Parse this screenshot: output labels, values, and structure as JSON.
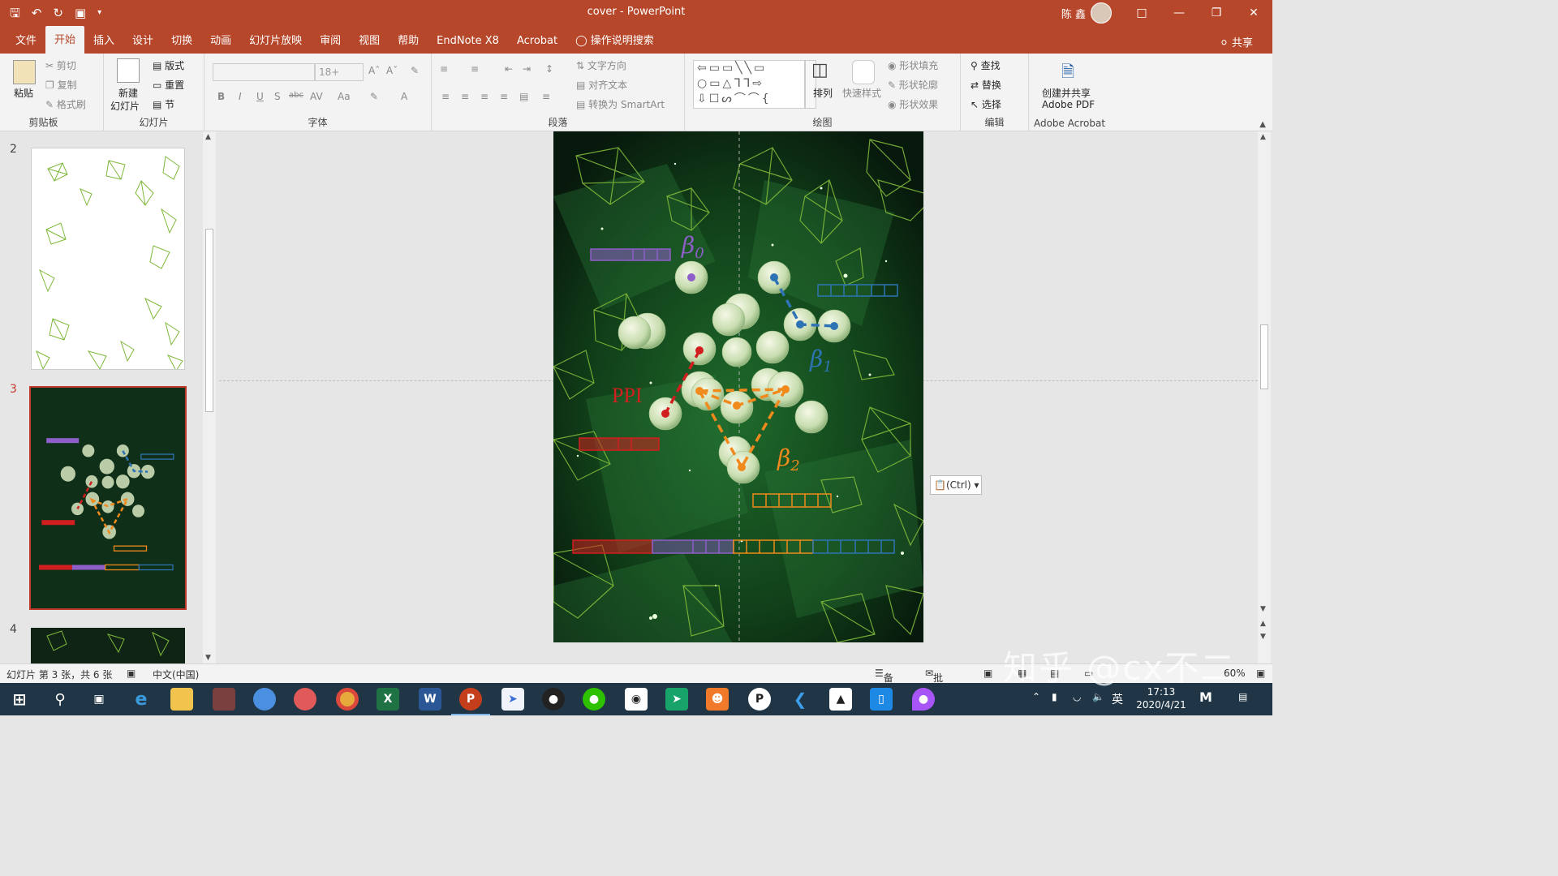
{
  "window": {
    "doc_name": "cover",
    "separator": "-",
    "app_name": "PowerPoint",
    "user_name": "陈 鑫"
  },
  "menu": {
    "tabs": [
      "文件",
      "开始",
      "插入",
      "设计",
      "切换",
      "动画",
      "幻灯片放映",
      "审阅",
      "视图",
      "帮助",
      "EndNote X8",
      "Acrobat"
    ],
    "active_tab": "开始",
    "tell_me": "操作说明搜索",
    "share": "共享"
  },
  "ribbon": {
    "clipboard": {
      "paste": "粘贴",
      "cut": "剪切",
      "copy": "复制",
      "format_painter": "格式刷",
      "label": "剪贴板"
    },
    "slides": {
      "new_slide": "新建",
      "new_slide2": "幻灯片",
      "layout": "版式",
      "reset": "重置",
      "section": "节",
      "label": "幻灯片"
    },
    "font": {
      "font_size": "18+",
      "label": "字体",
      "bold": "B",
      "italic": "I",
      "underline": "U",
      "shadow": "S",
      "strike": "abc",
      "spacing": "AV",
      "case": "Aa"
    },
    "paragraph": {
      "text_direction": "文字方向",
      "align_text": "对齐文本",
      "smartart": "转换为 SmartArt",
      "label": "段落"
    },
    "drawing": {
      "arrange": "排列",
      "quick_styles": "快速样式",
      "shape_fill": "形状填充",
      "shape_outline": "形状轮廓",
      "shape_effects": "形状效果",
      "label": "绘图"
    },
    "editing": {
      "find": "查找",
      "replace": "替换",
      "select": "选择",
      "label": "编辑"
    },
    "acrobat": {
      "create_share": "创建并共享",
      "adobe_pdf": "Adobe PDF",
      "label": "Adobe Acrobat"
    }
  },
  "thumbnails": [
    {
      "number": "2"
    },
    {
      "number": "3",
      "selected": true
    },
    {
      "number": "4"
    }
  ],
  "slide": {
    "beta0": "β",
    "beta0_sub": "0",
    "beta1": "β",
    "beta1_sub": "1",
    "beta2": "β",
    "beta2_sub": "2",
    "ppi": "PPI",
    "colors": {
      "purple": "#8e5ec9",
      "blue": "#2e74b5",
      "red": "#d11f1f",
      "orange": "#f08a1c",
      "bg": "#0c2414",
      "frame": "#7fb83a"
    }
  },
  "paste_options": "(Ctrl)",
  "status_bar": {
    "slide_info": "幻灯片 第 3 张，共 6 张",
    "language": "中文(中国)",
    "notes": "备注",
    "comments": "批注",
    "zoom": "60%"
  },
  "taskbar": {
    "time": "17:13",
    "date": "2020/4/21",
    "ime": "英"
  },
  "watermark": "知乎 @cx不二"
}
